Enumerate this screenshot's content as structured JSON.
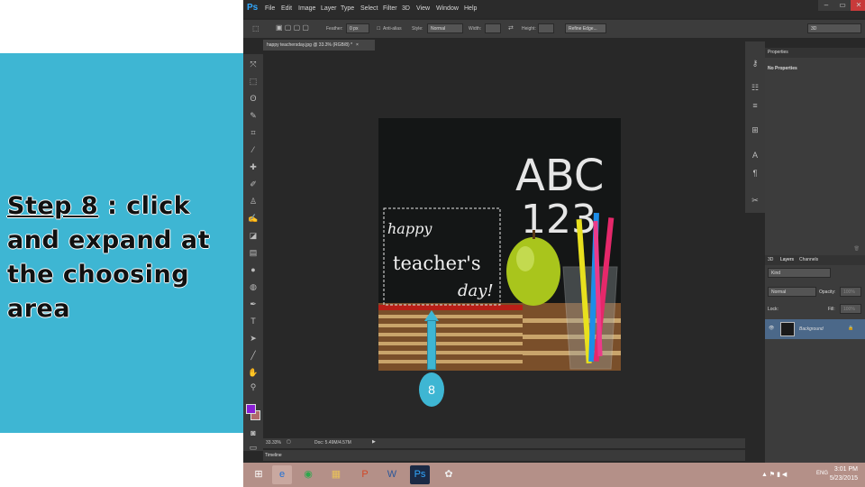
{
  "slide": {
    "step_label": "Step 8",
    "instruction_rest": " : click and expand at the choosing area",
    "callout_number": "8"
  },
  "app": {
    "logo": "Ps",
    "menus": [
      "File",
      "Edit",
      "Image",
      "Layer",
      "Type",
      "Select",
      "Filter",
      "3D",
      "View",
      "Window",
      "Help"
    ],
    "window_controls": [
      "–",
      "▭",
      "✕"
    ]
  },
  "options_bar": {
    "feather_label": "Feather:",
    "feather_value": "0 px",
    "antialias_label": "Anti-alias",
    "style_label": "Style:",
    "style_value": "Normal",
    "width_label": "Width:",
    "height_label": "Height:",
    "refine_edge": "Refine Edge...",
    "workspace": "3D"
  },
  "document": {
    "tab_title": "happy teachersday.jpg @ 33.3% (RGB/8) *",
    "zoom": "33.33%",
    "doc_size": "Doc: 5.49M/4.57M"
  },
  "image": {
    "chalk_abc": "ABC",
    "chalk_123": "123",
    "happy": "happy",
    "teachers": "teacher's",
    "day": "day!"
  },
  "timeline": {
    "label": "Timeline"
  },
  "properties": {
    "title": "Properties",
    "empty": "No Properties"
  },
  "layers": {
    "tabs": [
      "3D",
      "Layers",
      "Channels"
    ],
    "kind": "Kind",
    "blend_mode": "Normal",
    "opacity_label": "Opacity:",
    "opacity_value": "100%",
    "lock_label": "Lock:",
    "fill_label": "Fill:",
    "fill_value": "100%",
    "layer_name": "Background"
  },
  "taskbar": {
    "language": "ENG",
    "time": "3:01 PM",
    "date": "5/23/2015"
  },
  "colors": {
    "slide_accent": "#3eb6d3",
    "foreground_swatch": "#8a1fd6",
    "background_swatch": "#b06a6a"
  }
}
